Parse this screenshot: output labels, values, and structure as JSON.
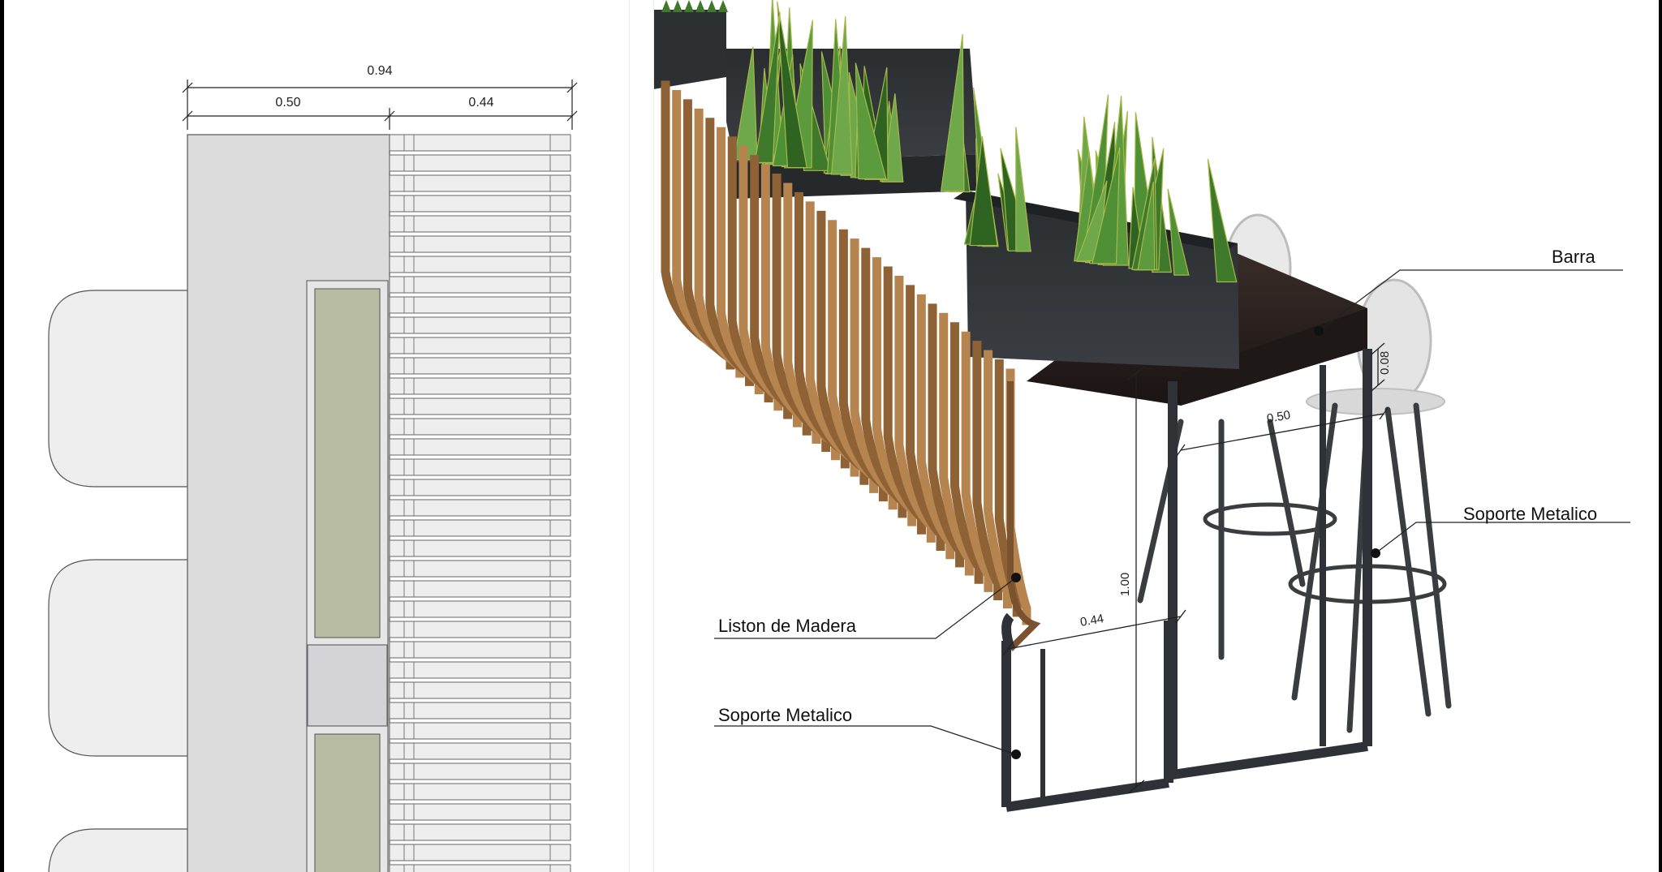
{
  "plan": {
    "dim_total": "0.94",
    "dim_seat": "0.50",
    "dim_bench": "0.44"
  },
  "iso": {
    "labels": {
      "barra": "Barra",
      "soporte_right": "Soporte Metalico",
      "liston": "Liston de Madera",
      "soporte_left": "Soporte Metalico"
    },
    "dims": {
      "d008": "0.08",
      "d050": "0.50",
      "d100": "1.00",
      "d044": "0.44"
    }
  },
  "colors": {
    "plan_fill": "#dcdcdc",
    "planter_green": "#b8bca2",
    "wood": "#a87a48",
    "metal": "#2e3236",
    "counter": "#2a2220",
    "leaf": "#3f7a2c"
  }
}
